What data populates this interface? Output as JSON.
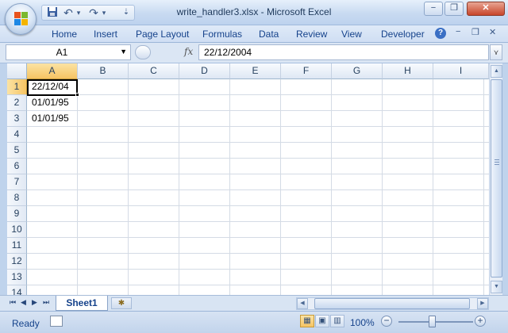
{
  "window": {
    "title": "write_handler3.xlsx - Microsoft Excel",
    "minimize_symbol": "−",
    "restore_symbol": "❐",
    "close_symbol": "✕"
  },
  "quick_access": {
    "save_icon": "save-icon",
    "undo_symbol": "↶",
    "undo_dropdown": "▾",
    "redo_symbol": "↷",
    "redo_dropdown": "▾",
    "customize_symbol": "⇣"
  },
  "ribbon": {
    "tabs": [
      "Home",
      "Insert",
      "Page Layout",
      "Formulas",
      "Data",
      "Review",
      "View",
      "Developer"
    ],
    "help_symbol": "?",
    "mini_minimize": "−",
    "mini_restore": "❐",
    "mini_close": "✕"
  },
  "formula_bar": {
    "name_box": "A1",
    "name_box_arrow": "▼",
    "fx_label": "fx",
    "content": "22/12/2004",
    "expand_symbol": "⋎"
  },
  "grid": {
    "columns": [
      "A",
      "B",
      "C",
      "D",
      "E",
      "F",
      "G",
      "H",
      "I"
    ],
    "rows": [
      "1",
      "2",
      "3",
      "4",
      "5",
      "6",
      "7",
      "8",
      "9",
      "10",
      "11",
      "12",
      "13",
      "14"
    ],
    "active_column": "A",
    "active_row": "1",
    "cells": {
      "A1": "22/12/04",
      "A2": "01/01/95",
      "A3": "01/01/95"
    }
  },
  "sheet_tabs": {
    "nav": [
      "⏮",
      "◀",
      "▶",
      "⏭"
    ],
    "tabs": [
      "Sheet1"
    ],
    "new_sheet_symbol": "✱"
  },
  "status": {
    "text": "Ready",
    "zoom": "100%",
    "zoom_out": "−",
    "zoom_in": "+",
    "view_normal": "▦",
    "view_page_layout": "▣",
    "view_page_break": "▥"
  },
  "colors": {
    "accent": "#15428b",
    "selected_header": "#f6c463",
    "gridline": "#d4dbe5"
  }
}
